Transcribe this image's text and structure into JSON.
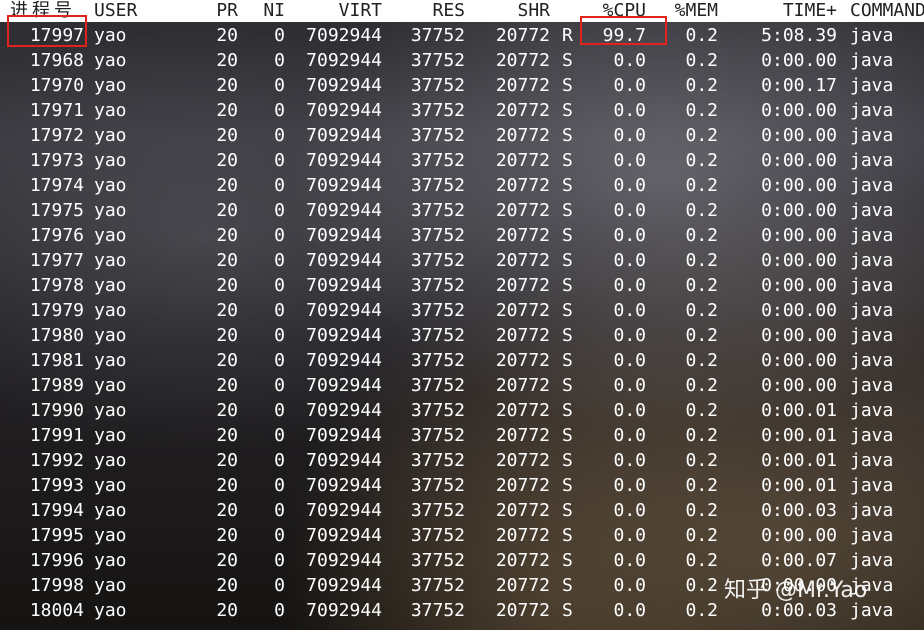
{
  "header": {
    "pid": "进程号",
    "user": "USER",
    "pr": "PR",
    "ni": "NI",
    "virt": "VIRT",
    "res": "RES",
    "shr": "SHR",
    "s": "",
    "cpu": "%CPU",
    "mem": "%MEM",
    "time": "TIME+",
    "command": "COMMAND"
  },
  "rows": [
    {
      "pid": "17997",
      "user": "yao",
      "pr": "20",
      "ni": "0",
      "virt": "7092944",
      "res": "37752",
      "shr": "20772",
      "s": "R",
      "cpu": "99.7",
      "mem": "0.2",
      "time": "5:08.39",
      "command": "java"
    },
    {
      "pid": "17968",
      "user": "yao",
      "pr": "20",
      "ni": "0",
      "virt": "7092944",
      "res": "37752",
      "shr": "20772",
      "s": "S",
      "cpu": "0.0",
      "mem": "0.2",
      "time": "0:00.00",
      "command": "java"
    },
    {
      "pid": "17970",
      "user": "yao",
      "pr": "20",
      "ni": "0",
      "virt": "7092944",
      "res": "37752",
      "shr": "20772",
      "s": "S",
      "cpu": "0.0",
      "mem": "0.2",
      "time": "0:00.17",
      "command": "java"
    },
    {
      "pid": "17971",
      "user": "yao",
      "pr": "20",
      "ni": "0",
      "virt": "7092944",
      "res": "37752",
      "shr": "20772",
      "s": "S",
      "cpu": "0.0",
      "mem": "0.2",
      "time": "0:00.00",
      "command": "java"
    },
    {
      "pid": "17972",
      "user": "yao",
      "pr": "20",
      "ni": "0",
      "virt": "7092944",
      "res": "37752",
      "shr": "20772",
      "s": "S",
      "cpu": "0.0",
      "mem": "0.2",
      "time": "0:00.00",
      "command": "java"
    },
    {
      "pid": "17973",
      "user": "yao",
      "pr": "20",
      "ni": "0",
      "virt": "7092944",
      "res": "37752",
      "shr": "20772",
      "s": "S",
      "cpu": "0.0",
      "mem": "0.2",
      "time": "0:00.00",
      "command": "java"
    },
    {
      "pid": "17974",
      "user": "yao",
      "pr": "20",
      "ni": "0",
      "virt": "7092944",
      "res": "37752",
      "shr": "20772",
      "s": "S",
      "cpu": "0.0",
      "mem": "0.2",
      "time": "0:00.00",
      "command": "java"
    },
    {
      "pid": "17975",
      "user": "yao",
      "pr": "20",
      "ni": "0",
      "virt": "7092944",
      "res": "37752",
      "shr": "20772",
      "s": "S",
      "cpu": "0.0",
      "mem": "0.2",
      "time": "0:00.00",
      "command": "java"
    },
    {
      "pid": "17976",
      "user": "yao",
      "pr": "20",
      "ni": "0",
      "virt": "7092944",
      "res": "37752",
      "shr": "20772",
      "s": "S",
      "cpu": "0.0",
      "mem": "0.2",
      "time": "0:00.00",
      "command": "java"
    },
    {
      "pid": "17977",
      "user": "yao",
      "pr": "20",
      "ni": "0",
      "virt": "7092944",
      "res": "37752",
      "shr": "20772",
      "s": "S",
      "cpu": "0.0",
      "mem": "0.2",
      "time": "0:00.00",
      "command": "java"
    },
    {
      "pid": "17978",
      "user": "yao",
      "pr": "20",
      "ni": "0",
      "virt": "7092944",
      "res": "37752",
      "shr": "20772",
      "s": "S",
      "cpu": "0.0",
      "mem": "0.2",
      "time": "0:00.00",
      "command": "java"
    },
    {
      "pid": "17979",
      "user": "yao",
      "pr": "20",
      "ni": "0",
      "virt": "7092944",
      "res": "37752",
      "shr": "20772",
      "s": "S",
      "cpu": "0.0",
      "mem": "0.2",
      "time": "0:00.00",
      "command": "java"
    },
    {
      "pid": "17980",
      "user": "yao",
      "pr": "20",
      "ni": "0",
      "virt": "7092944",
      "res": "37752",
      "shr": "20772",
      "s": "S",
      "cpu": "0.0",
      "mem": "0.2",
      "time": "0:00.00",
      "command": "java"
    },
    {
      "pid": "17981",
      "user": "yao",
      "pr": "20",
      "ni": "0",
      "virt": "7092944",
      "res": "37752",
      "shr": "20772",
      "s": "S",
      "cpu": "0.0",
      "mem": "0.2",
      "time": "0:00.00",
      "command": "java"
    },
    {
      "pid": "17989",
      "user": "yao",
      "pr": "20",
      "ni": "0",
      "virt": "7092944",
      "res": "37752",
      "shr": "20772",
      "s": "S",
      "cpu": "0.0",
      "mem": "0.2",
      "time": "0:00.00",
      "command": "java"
    },
    {
      "pid": "17990",
      "user": "yao",
      "pr": "20",
      "ni": "0",
      "virt": "7092944",
      "res": "37752",
      "shr": "20772",
      "s": "S",
      "cpu": "0.0",
      "mem": "0.2",
      "time": "0:00.01",
      "command": "java"
    },
    {
      "pid": "17991",
      "user": "yao",
      "pr": "20",
      "ni": "0",
      "virt": "7092944",
      "res": "37752",
      "shr": "20772",
      "s": "S",
      "cpu": "0.0",
      "mem": "0.2",
      "time": "0:00.01",
      "command": "java"
    },
    {
      "pid": "17992",
      "user": "yao",
      "pr": "20",
      "ni": "0",
      "virt": "7092944",
      "res": "37752",
      "shr": "20772",
      "s": "S",
      "cpu": "0.0",
      "mem": "0.2",
      "time": "0:00.01",
      "command": "java"
    },
    {
      "pid": "17993",
      "user": "yao",
      "pr": "20",
      "ni": "0",
      "virt": "7092944",
      "res": "37752",
      "shr": "20772",
      "s": "S",
      "cpu": "0.0",
      "mem": "0.2",
      "time": "0:00.01",
      "command": "java"
    },
    {
      "pid": "17994",
      "user": "yao",
      "pr": "20",
      "ni": "0",
      "virt": "7092944",
      "res": "37752",
      "shr": "20772",
      "s": "S",
      "cpu": "0.0",
      "mem": "0.2",
      "time": "0:00.03",
      "command": "java"
    },
    {
      "pid": "17995",
      "user": "yao",
      "pr": "20",
      "ni": "0",
      "virt": "7092944",
      "res": "37752",
      "shr": "20772",
      "s": "S",
      "cpu": "0.0",
      "mem": "0.2",
      "time": "0:00.00",
      "command": "java"
    },
    {
      "pid": "17996",
      "user": "yao",
      "pr": "20",
      "ni": "0",
      "virt": "7092944",
      "res": "37752",
      "shr": "20772",
      "s": "S",
      "cpu": "0.0",
      "mem": "0.2",
      "time": "0:00.07",
      "command": "java"
    },
    {
      "pid": "17998",
      "user": "yao",
      "pr": "20",
      "ni": "0",
      "virt": "7092944",
      "res": "37752",
      "shr": "20772",
      "s": "S",
      "cpu": "0.0",
      "mem": "0.2",
      "time": "0:00.00",
      "command": "java"
    },
    {
      "pid": "18004",
      "user": "yao",
      "pr": "20",
      "ni": "0",
      "virt": "7092944",
      "res": "37752",
      "shr": "20772",
      "s": "S",
      "cpu": "0.0",
      "mem": "0.2",
      "time": "0:00.03",
      "command": "java"
    }
  ],
  "highlight_color": "#e0231b",
  "watermark": "知乎 @Mr.Yao"
}
